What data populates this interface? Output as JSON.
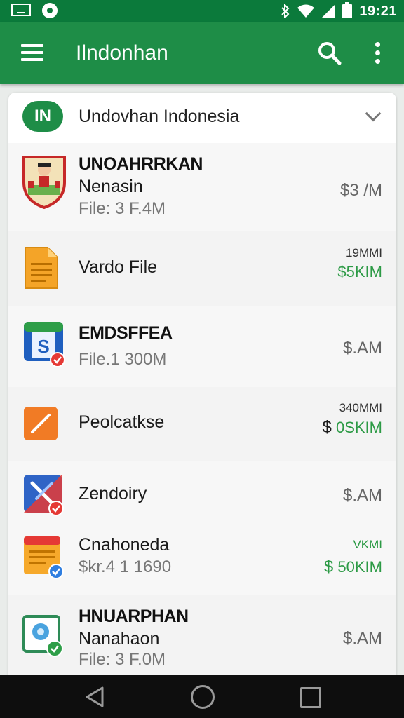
{
  "status_bar": {
    "time": "19:21"
  },
  "app_bar": {
    "title": "Ilndonhan"
  },
  "card": {
    "badge": "IN",
    "title": "Undovhan Indonesia",
    "rows": [
      {
        "title": "UNOAHRRKAN",
        "main": "Nenasin",
        "sub": "File: 3 F.4M",
        "price": "$3 /M",
        "icon": "crest-icon"
      },
      {
        "main": "Vardo File",
        "small": "19MMI",
        "green": "$5KIM",
        "icon": "document-icon"
      },
      {
        "title": "EMDSFFEA",
        "sub": "File.1 300M",
        "price": "$.AM",
        "icon": "spreadsheet-icon"
      },
      {
        "main": "Peolcatkse",
        "small": "340MMI",
        "green_dollar": "$",
        "green": "0SKIM",
        "icon": "pencil-icon"
      },
      {
        "main": "Zendoiry",
        "price": "$.AM",
        "icon": "tools-icon"
      },
      {
        "main": "Cnahoneda",
        "sub": "$kr.4 1 1690",
        "small": "VKMI",
        "green_dollar": "$",
        "green": "50KIM",
        "icon": "calendar-icon"
      },
      {
        "title": "HNUARPHAN",
        "main": "Nanahaon",
        "sub": "File: 3 F.0M",
        "price": "$.AM",
        "icon": "photo-icon"
      }
    ]
  },
  "colors": {
    "status_bar": "#0b7a3b",
    "app_bar": "#1e8d47",
    "green_text": "#2c9a45"
  }
}
